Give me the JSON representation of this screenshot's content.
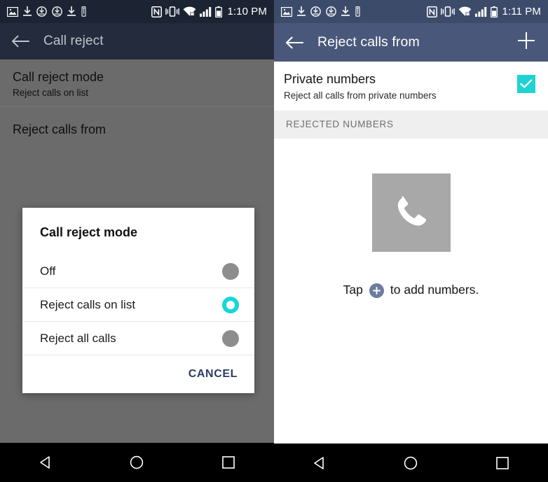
{
  "left_phone": {
    "status_bar": {
      "time": "1:10 PM",
      "left_icons": [
        "image-icon",
        "download-icon",
        "sync-icon",
        "sync-icon",
        "download-icon",
        "usb-icon"
      ],
      "right_icons": [
        "nfc-icon",
        "vibrate-icon",
        "wifi-secure-icon",
        "signal-icon",
        "battery-icon"
      ],
      "background_color": "#1c2433"
    },
    "app_bar": {
      "back_label": "back-arrow-icon",
      "title": "Call reject",
      "background_color": "#232b3c"
    },
    "settings": [
      {
        "title": "Call reject mode",
        "subtitle": "Reject calls on list"
      },
      {
        "title": "Reject calls from",
        "subtitle": ""
      }
    ],
    "dialog": {
      "title": "Call reject mode",
      "options": [
        {
          "label": "Off",
          "selected": false
        },
        {
          "label": "Reject calls on list",
          "selected": true
        },
        {
          "label": "Reject all calls",
          "selected": false
        }
      ],
      "cancel_label": "CANCEL",
      "selected_color": "#18d6d6",
      "unselected_color": "#8d8d8d",
      "cancel_color": "#2b3d63"
    },
    "nav_bar": {
      "back": "back-triangle-icon",
      "home": "home-circle-icon",
      "recents": "recents-square-icon"
    }
  },
  "right_phone": {
    "status_bar": {
      "time": "1:11 PM",
      "left_icons": [
        "image-icon",
        "download-icon",
        "sync-icon",
        "sync-icon",
        "download-icon",
        "usb-icon"
      ],
      "right_icons": [
        "nfc-icon",
        "vibrate-icon",
        "wifi-secure-icon",
        "signal-icon",
        "battery-icon"
      ],
      "background_color": "#3d4b6b"
    },
    "app_bar": {
      "back_label": "back-arrow-icon",
      "title": "Reject calls from",
      "add_label": "plus-icon",
      "background_color": "#49587a"
    },
    "private_numbers": {
      "title": "Private numbers",
      "subtitle": "Reject all calls from private numbers",
      "checked": true,
      "check_color": "#1fd3d3"
    },
    "section_header": "REJECTED NUMBERS",
    "empty_state": {
      "icon": "phone-handset-icon",
      "text_before": "Tap",
      "badge_icon": "plus-circle-icon",
      "text_after": "to add numbers.",
      "badge_color": "#6b7d9e",
      "icon_tile_color": "#a8a8a8"
    },
    "nav_bar": {
      "back": "back-triangle-icon",
      "home": "home-circle-icon",
      "recents": "recents-square-icon"
    }
  }
}
